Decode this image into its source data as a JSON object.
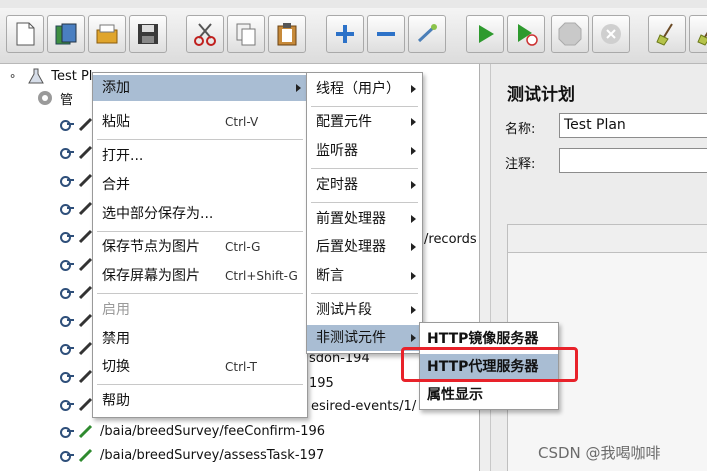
{
  "tree": {
    "root_label": "Test Plan",
    "child_label": "管",
    "visible_fragments": [
      "/records",
      "sdon-194",
      "195",
      "esired-events/1/"
    ],
    "rows": [
      "/baia/breedSurvey/feeConfirm-196",
      "/baia/breedSurvey/assessTask-197"
    ]
  },
  "right_panel": {
    "title": "测试计划",
    "name_label": "名称:",
    "name_value": "Test Plan",
    "comment_label": "注释:"
  },
  "context_menu": {
    "items": [
      {
        "label": "添加",
        "submenu": true
      },
      {
        "label": "粘贴",
        "shortcut": "Ctrl-V"
      },
      {
        "label": "打开..."
      },
      {
        "label": "合并"
      },
      {
        "label": "选中部分保存为..."
      },
      {
        "label": "保存节点为图片",
        "shortcut": "Ctrl-G"
      },
      {
        "label": "保存屏幕为图片",
        "shortcut": "Ctrl+Shift-G"
      },
      {
        "label": "启用",
        "disabled": true
      },
      {
        "label": "禁用"
      },
      {
        "label": "切换",
        "shortcut": "Ctrl-T"
      },
      {
        "label": "帮助"
      }
    ]
  },
  "add_submenu": {
    "items": [
      {
        "label": "线程（用户）"
      },
      {
        "label": "配置元件"
      },
      {
        "label": "监听器"
      },
      {
        "label": "定时器"
      },
      {
        "label": "前置处理器"
      },
      {
        "label": "后置处理器"
      },
      {
        "label": "断言"
      },
      {
        "label": "测试片段"
      },
      {
        "label": "非测试元件"
      }
    ]
  },
  "non_test_submenu": {
    "items": [
      {
        "label": "HTTP镜像服务器"
      },
      {
        "label": "HTTP代理服务器"
      },
      {
        "label": "属性显示"
      }
    ]
  },
  "colors": {
    "highlight_border": "#e8222a",
    "menu_selected": "#a9bdd3"
  },
  "watermark": "CSDN @我喝咖啡"
}
